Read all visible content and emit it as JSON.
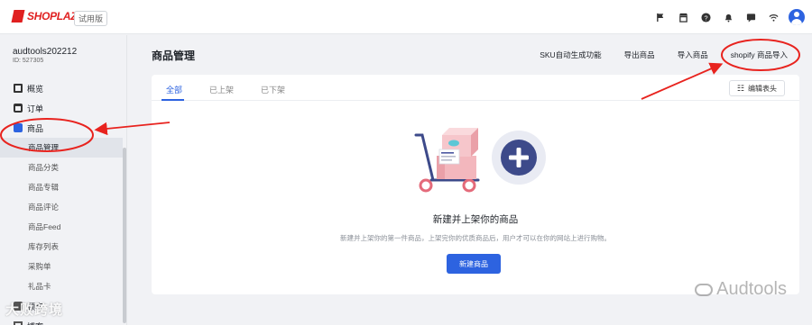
{
  "topbar": {
    "brand": "SHOPLAZZA",
    "trial_badge": "试用版",
    "icons": [
      "flag-icon",
      "store-icon",
      "help-icon",
      "bell-icon",
      "message-icon",
      "wifi-icon",
      "user-avatar"
    ]
  },
  "sidebar": {
    "store_name": "audtools202212",
    "store_id": "ID: 527305",
    "items": [
      {
        "label": "概览",
        "icon": "overview-icon"
      },
      {
        "label": "订单",
        "icon": "order-icon"
      },
      {
        "label": "商品",
        "icon": "product-icon"
      }
    ],
    "sub_items": [
      "商品管理",
      "商品分类",
      "商品专辑",
      "商品评论",
      "商品Feed",
      "库存列表",
      "采购单",
      "礼品卡"
    ],
    "bottom_items": [
      "顾客",
      "博客"
    ]
  },
  "main": {
    "title": "商品管理",
    "actions": [
      "SKU自动生成功能",
      "导出商品",
      "导入商品",
      "shopify 商品导入"
    ],
    "tabs": [
      "全部",
      "已上架",
      "已下架"
    ],
    "edit_columns": "编辑表头",
    "empty_title": "新建并上架你的商品",
    "empty_desc": "新建并上架你的第一件商品，上架完你的优质商品后，用户才可以在你的网站上进行购物。",
    "new_button": "新建商品"
  },
  "watermarks": {
    "left": "大败跨境",
    "right": "Audtools"
  },
  "colors": {
    "accent": "#2d63e0",
    "brand_red": "#e02020",
    "annotation_red": "#e8231e"
  }
}
